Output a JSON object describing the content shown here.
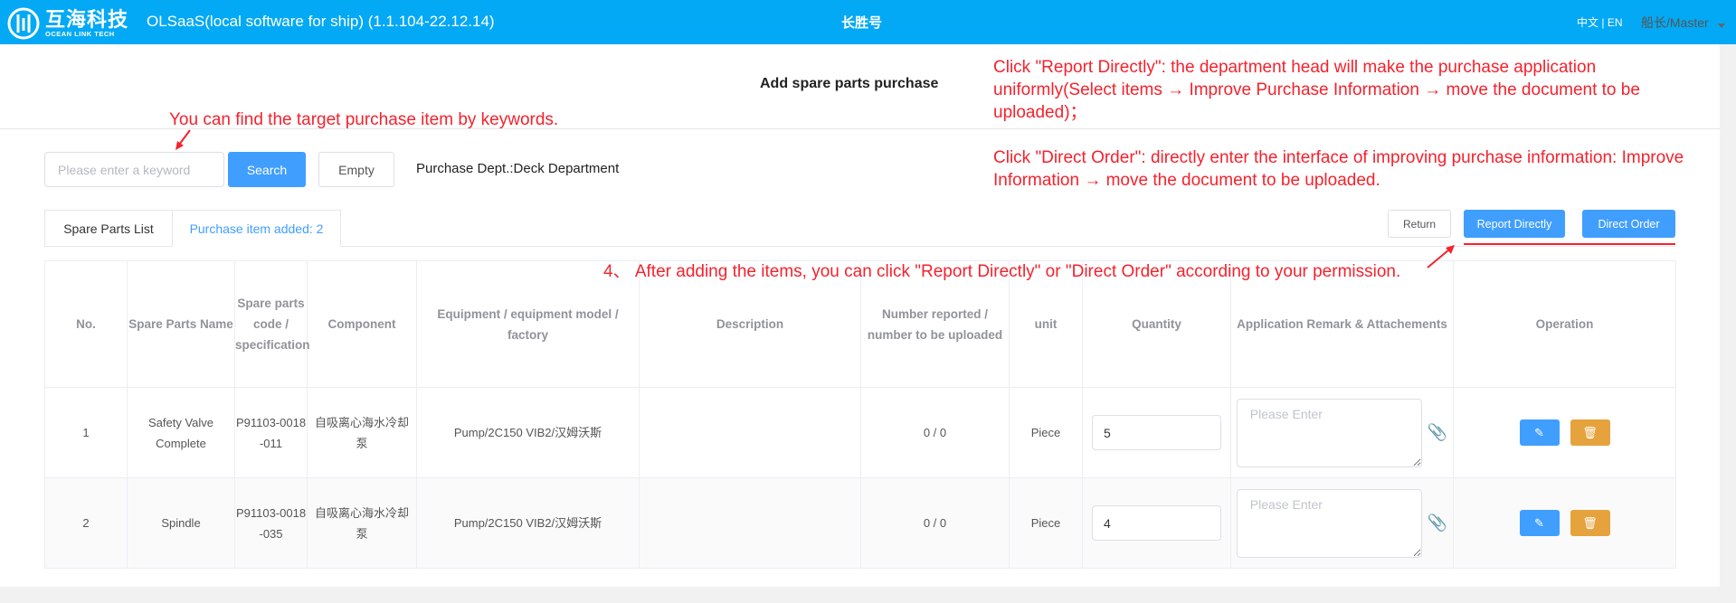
{
  "header": {
    "logo_cn": "互海科技",
    "logo_en": "OCEAN LINK TECH",
    "app_title": "OLSaaS(local software for ship)  (1.1.104-22.12.14)",
    "ship_name": "长胜号",
    "lang_cn": "中文",
    "lang_sep": "|",
    "lang_en": "EN",
    "user": "船长/Master",
    "brand_color": "#03a9f4"
  },
  "page": {
    "title": "Add spare parts purchase"
  },
  "search": {
    "placeholder": "Please enter a keyword",
    "value": "",
    "search_label": "Search",
    "empty_label": "Empty",
    "dept": "Purchase Dept.:Deck Department"
  },
  "tabs": [
    {
      "label": "Spare Parts List",
      "active": false
    },
    {
      "label": "Purchase item added: 2",
      "active": true
    }
  ],
  "actions": {
    "return": "Return",
    "report": "Report Directly",
    "order": "Direct Order"
  },
  "annotations": {
    "keyword": "You can find the target purchase item by keywords.",
    "report": "Click \"Report Directly\": the department head will make the purchase application uniformly(Select items → Improve Purchase Information → move the document to be uploaded)；",
    "order": "Click \"Direct Order\": directly enter the interface of improving purchase information: Improve Information → move the document to be uploaded.",
    "step4": "4、 After adding the items, you can click \"Report Directly\" or \"Direct Order\" according to your permission."
  },
  "table": {
    "columns": [
      "No.",
      "Spare Parts Name",
      "Spare parts code / specification",
      "Component",
      "Equipment / equipment model / factory",
      "Description",
      "Number reported / number to be uploaded",
      "unit",
      "Quantity",
      "Application Remark & Attachements",
      "Operation"
    ],
    "remark_placeholder": "Please Enter",
    "rows": [
      {
        "no": "1",
        "name": "Safety Valve Complete",
        "code": "P91103-0018-011",
        "component": "自吸离心海水冷却泵",
        "equipment": "Pump/2C150 VIB2/汉姆沃斯",
        "description": "",
        "reported": "0 / 0",
        "unit": "Piece",
        "quantity": "5",
        "remark": ""
      },
      {
        "no": "2",
        "name": "Spindle",
        "code": "P91103-0018-035",
        "component": "自吸离心海水冷却泵",
        "equipment": "Pump/2C150 VIB2/汉姆沃斯",
        "description": "",
        "reported": "0 / 0",
        "unit": "Piece",
        "quantity": "4",
        "remark": ""
      }
    ]
  }
}
